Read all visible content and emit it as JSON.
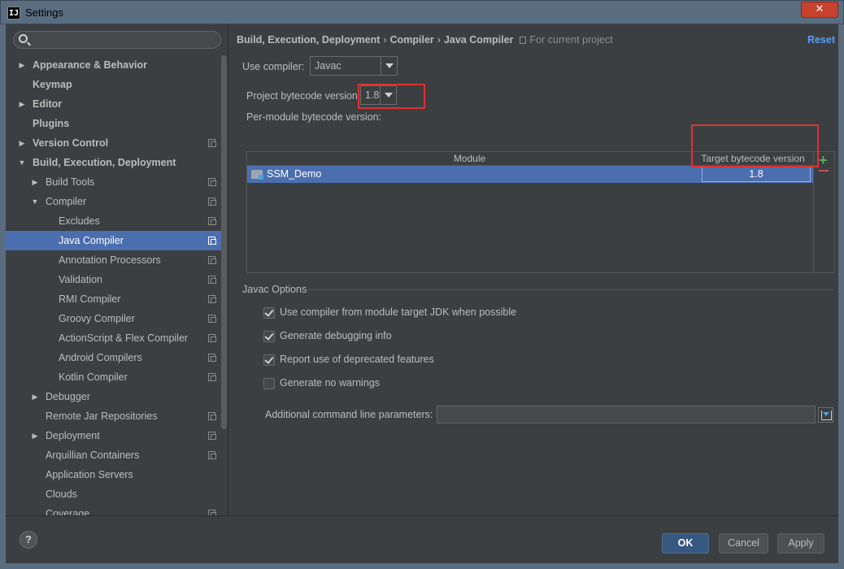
{
  "window": {
    "title": "Settings",
    "app_icon_text": "IJ",
    "close_glyph": "✕"
  },
  "search": {
    "placeholder": "",
    "value": ""
  },
  "sidebar": {
    "items": [
      {
        "label": "Appearance & Behavior",
        "level": 0,
        "arrow": "right",
        "bold": true,
        "project_icon": false
      },
      {
        "label": "Keymap",
        "level": 0,
        "arrow": "none",
        "bold": true,
        "project_icon": false
      },
      {
        "label": "Editor",
        "level": 0,
        "arrow": "right",
        "bold": true,
        "project_icon": false
      },
      {
        "label": "Plugins",
        "level": 0,
        "arrow": "none",
        "bold": true,
        "project_icon": false
      },
      {
        "label": "Version Control",
        "level": 0,
        "arrow": "right",
        "bold": true,
        "project_icon": true
      },
      {
        "label": "Build, Execution, Deployment",
        "level": 0,
        "arrow": "down",
        "bold": true,
        "project_icon": false
      },
      {
        "label": "Build Tools",
        "level": 1,
        "arrow": "right",
        "bold": false,
        "project_icon": true
      },
      {
        "label": "Compiler",
        "level": 1,
        "arrow": "down",
        "bold": false,
        "project_icon": true
      },
      {
        "label": "Excludes",
        "level": 2,
        "arrow": "none",
        "bold": false,
        "project_icon": true
      },
      {
        "label": "Java Compiler",
        "level": 2,
        "arrow": "none",
        "bold": false,
        "project_icon": true,
        "selected": true
      },
      {
        "label": "Annotation Processors",
        "level": 2,
        "arrow": "none",
        "bold": false,
        "project_icon": true
      },
      {
        "label": "Validation",
        "level": 2,
        "arrow": "none",
        "bold": false,
        "project_icon": true
      },
      {
        "label": "RMI Compiler",
        "level": 2,
        "arrow": "none",
        "bold": false,
        "project_icon": true
      },
      {
        "label": "Groovy Compiler",
        "level": 2,
        "arrow": "none",
        "bold": false,
        "project_icon": true
      },
      {
        "label": "ActionScript & Flex Compiler",
        "level": 2,
        "arrow": "none",
        "bold": false,
        "project_icon": true
      },
      {
        "label": "Android Compilers",
        "level": 2,
        "arrow": "none",
        "bold": false,
        "project_icon": true
      },
      {
        "label": "Kotlin Compiler",
        "level": 2,
        "arrow": "none",
        "bold": false,
        "project_icon": true
      },
      {
        "label": "Debugger",
        "level": 1,
        "arrow": "right",
        "bold": false,
        "project_icon": false
      },
      {
        "label": "Remote Jar Repositories",
        "level": 1,
        "arrow": "none",
        "bold": false,
        "project_icon": true
      },
      {
        "label": "Deployment",
        "level": 1,
        "arrow": "right",
        "bold": false,
        "project_icon": true
      },
      {
        "label": "Arquillian Containers",
        "level": 1,
        "arrow": "none",
        "bold": false,
        "project_icon": true
      },
      {
        "label": "Application Servers",
        "level": 1,
        "arrow": "none",
        "bold": false,
        "project_icon": false
      },
      {
        "label": "Clouds",
        "level": 1,
        "arrow": "none",
        "bold": false,
        "project_icon": false
      },
      {
        "label": "Coverage",
        "level": 1,
        "arrow": "none",
        "bold": false,
        "project_icon": true
      }
    ]
  },
  "breadcrumb": {
    "parts": [
      "Build, Execution, Deployment",
      "Compiler",
      "Java Compiler"
    ],
    "separator": "›",
    "scope": "For current project"
  },
  "reset_label": "Reset",
  "compiler": {
    "label": "Use compiler:",
    "value": "Javac"
  },
  "project_bytecode": {
    "label": "Project bytecode version:",
    "value": "1.8"
  },
  "per_module": {
    "label": "Per-module bytecode version:",
    "columns": [
      "Module",
      "Target bytecode version"
    ],
    "rows": [
      {
        "module": "SSM_Demo",
        "target": "1.8"
      }
    ],
    "add_glyph": "+"
  },
  "javac": {
    "group_label": "Javac Options",
    "options": [
      {
        "label": "Use compiler from module target JDK when possible",
        "checked": true
      },
      {
        "label": "Generate debugging info",
        "checked": true
      },
      {
        "label": "Report use of deprecated features",
        "checked": true
      },
      {
        "label": "Generate no warnings",
        "checked": false
      }
    ],
    "params_label": "Additional command line parameters:",
    "params_value": ""
  },
  "footer": {
    "help": "?",
    "ok": "OK",
    "cancel": "Cancel",
    "apply": "Apply"
  },
  "colors": {
    "selection": "#4b6eaf",
    "link": "#589df6",
    "highlight_box": "#e03030",
    "add": "#59a869",
    "remove": "#c75450"
  }
}
